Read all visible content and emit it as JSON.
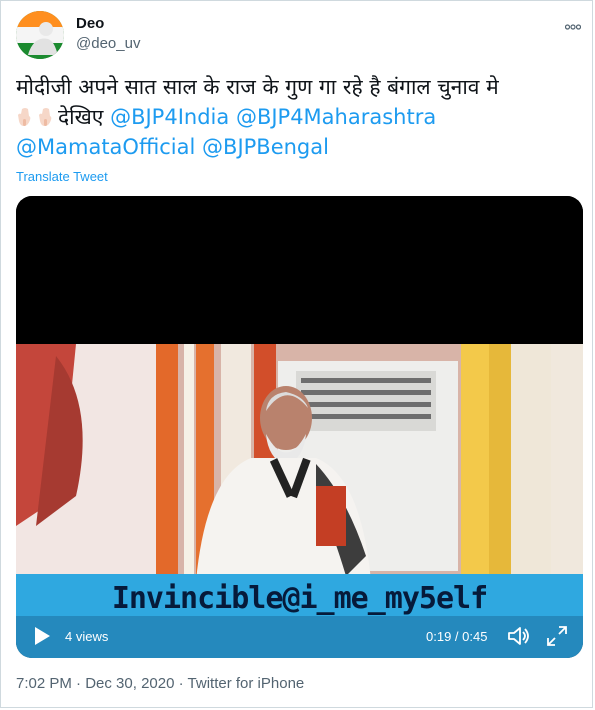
{
  "author": {
    "display_name": "Deo",
    "handle": "@deo_uv"
  },
  "more_icon": "more-horizontal-icon",
  "tweet": {
    "text_line1": "मोदीजी अपने सात साल के राज के गुण गा रहे है बंगाल चुनाव मे",
    "text_line2_prefix": "देखिए",
    "mentions": [
      "@BJP4India",
      "@BJP4Maharashtra",
      "@MamataOfficial",
      "@BJPBengal"
    ],
    "emoji": [
      "backhand-index-pointing-down",
      "backhand-index-pointing-down"
    ]
  },
  "translate_label": "Translate Tweet",
  "video": {
    "overlay_text": "Invincible@i_me_my5elf",
    "views": "4 views",
    "time": "0:19 / 0:45"
  },
  "meta": {
    "time": "7:02 PM",
    "date": "Dec 30, 2020",
    "source": "Twitter for iPhone",
    "separator": "·"
  },
  "colors": {
    "link": "#1d9bf0",
    "text": "#0f1419",
    "muted": "#536471",
    "overlay_band": "#2fa8e0"
  }
}
